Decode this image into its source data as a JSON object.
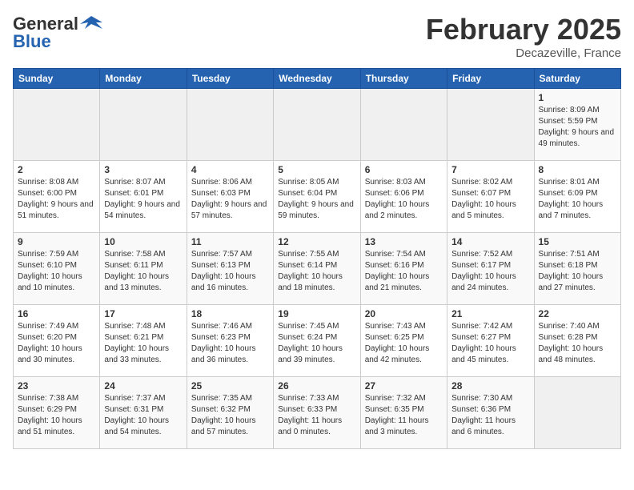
{
  "header": {
    "logo_general": "General",
    "logo_blue": "Blue",
    "month_title": "February 2025",
    "location": "Decazeville, France"
  },
  "weekdays": [
    "Sunday",
    "Monday",
    "Tuesday",
    "Wednesday",
    "Thursday",
    "Friday",
    "Saturday"
  ],
  "weeks": [
    [
      {
        "day": "",
        "info": ""
      },
      {
        "day": "",
        "info": ""
      },
      {
        "day": "",
        "info": ""
      },
      {
        "day": "",
        "info": ""
      },
      {
        "day": "",
        "info": ""
      },
      {
        "day": "",
        "info": ""
      },
      {
        "day": "1",
        "info": "Sunrise: 8:09 AM\nSunset: 5:59 PM\nDaylight: 9 hours and 49 minutes."
      }
    ],
    [
      {
        "day": "2",
        "info": "Sunrise: 8:08 AM\nSunset: 6:00 PM\nDaylight: 9 hours and 51 minutes."
      },
      {
        "day": "3",
        "info": "Sunrise: 8:07 AM\nSunset: 6:01 PM\nDaylight: 9 hours and 54 minutes."
      },
      {
        "day": "4",
        "info": "Sunrise: 8:06 AM\nSunset: 6:03 PM\nDaylight: 9 hours and 57 minutes."
      },
      {
        "day": "5",
        "info": "Sunrise: 8:05 AM\nSunset: 6:04 PM\nDaylight: 9 hours and 59 minutes."
      },
      {
        "day": "6",
        "info": "Sunrise: 8:03 AM\nSunset: 6:06 PM\nDaylight: 10 hours and 2 minutes."
      },
      {
        "day": "7",
        "info": "Sunrise: 8:02 AM\nSunset: 6:07 PM\nDaylight: 10 hours and 5 minutes."
      },
      {
        "day": "8",
        "info": "Sunrise: 8:01 AM\nSunset: 6:09 PM\nDaylight: 10 hours and 7 minutes."
      }
    ],
    [
      {
        "day": "9",
        "info": "Sunrise: 7:59 AM\nSunset: 6:10 PM\nDaylight: 10 hours and 10 minutes."
      },
      {
        "day": "10",
        "info": "Sunrise: 7:58 AM\nSunset: 6:11 PM\nDaylight: 10 hours and 13 minutes."
      },
      {
        "day": "11",
        "info": "Sunrise: 7:57 AM\nSunset: 6:13 PM\nDaylight: 10 hours and 16 minutes."
      },
      {
        "day": "12",
        "info": "Sunrise: 7:55 AM\nSunset: 6:14 PM\nDaylight: 10 hours and 18 minutes."
      },
      {
        "day": "13",
        "info": "Sunrise: 7:54 AM\nSunset: 6:16 PM\nDaylight: 10 hours and 21 minutes."
      },
      {
        "day": "14",
        "info": "Sunrise: 7:52 AM\nSunset: 6:17 PM\nDaylight: 10 hours and 24 minutes."
      },
      {
        "day": "15",
        "info": "Sunrise: 7:51 AM\nSunset: 6:18 PM\nDaylight: 10 hours and 27 minutes."
      }
    ],
    [
      {
        "day": "16",
        "info": "Sunrise: 7:49 AM\nSunset: 6:20 PM\nDaylight: 10 hours and 30 minutes."
      },
      {
        "day": "17",
        "info": "Sunrise: 7:48 AM\nSunset: 6:21 PM\nDaylight: 10 hours and 33 minutes."
      },
      {
        "day": "18",
        "info": "Sunrise: 7:46 AM\nSunset: 6:23 PM\nDaylight: 10 hours and 36 minutes."
      },
      {
        "day": "19",
        "info": "Sunrise: 7:45 AM\nSunset: 6:24 PM\nDaylight: 10 hours and 39 minutes."
      },
      {
        "day": "20",
        "info": "Sunrise: 7:43 AM\nSunset: 6:25 PM\nDaylight: 10 hours and 42 minutes."
      },
      {
        "day": "21",
        "info": "Sunrise: 7:42 AM\nSunset: 6:27 PM\nDaylight: 10 hours and 45 minutes."
      },
      {
        "day": "22",
        "info": "Sunrise: 7:40 AM\nSunset: 6:28 PM\nDaylight: 10 hours and 48 minutes."
      }
    ],
    [
      {
        "day": "23",
        "info": "Sunrise: 7:38 AM\nSunset: 6:29 PM\nDaylight: 10 hours and 51 minutes."
      },
      {
        "day": "24",
        "info": "Sunrise: 7:37 AM\nSunset: 6:31 PM\nDaylight: 10 hours and 54 minutes."
      },
      {
        "day": "25",
        "info": "Sunrise: 7:35 AM\nSunset: 6:32 PM\nDaylight: 10 hours and 57 minutes."
      },
      {
        "day": "26",
        "info": "Sunrise: 7:33 AM\nSunset: 6:33 PM\nDaylight: 11 hours and 0 minutes."
      },
      {
        "day": "27",
        "info": "Sunrise: 7:32 AM\nSunset: 6:35 PM\nDaylight: 11 hours and 3 minutes."
      },
      {
        "day": "28",
        "info": "Sunrise: 7:30 AM\nSunset: 6:36 PM\nDaylight: 11 hours and 6 minutes."
      },
      {
        "day": "",
        "info": ""
      }
    ]
  ]
}
